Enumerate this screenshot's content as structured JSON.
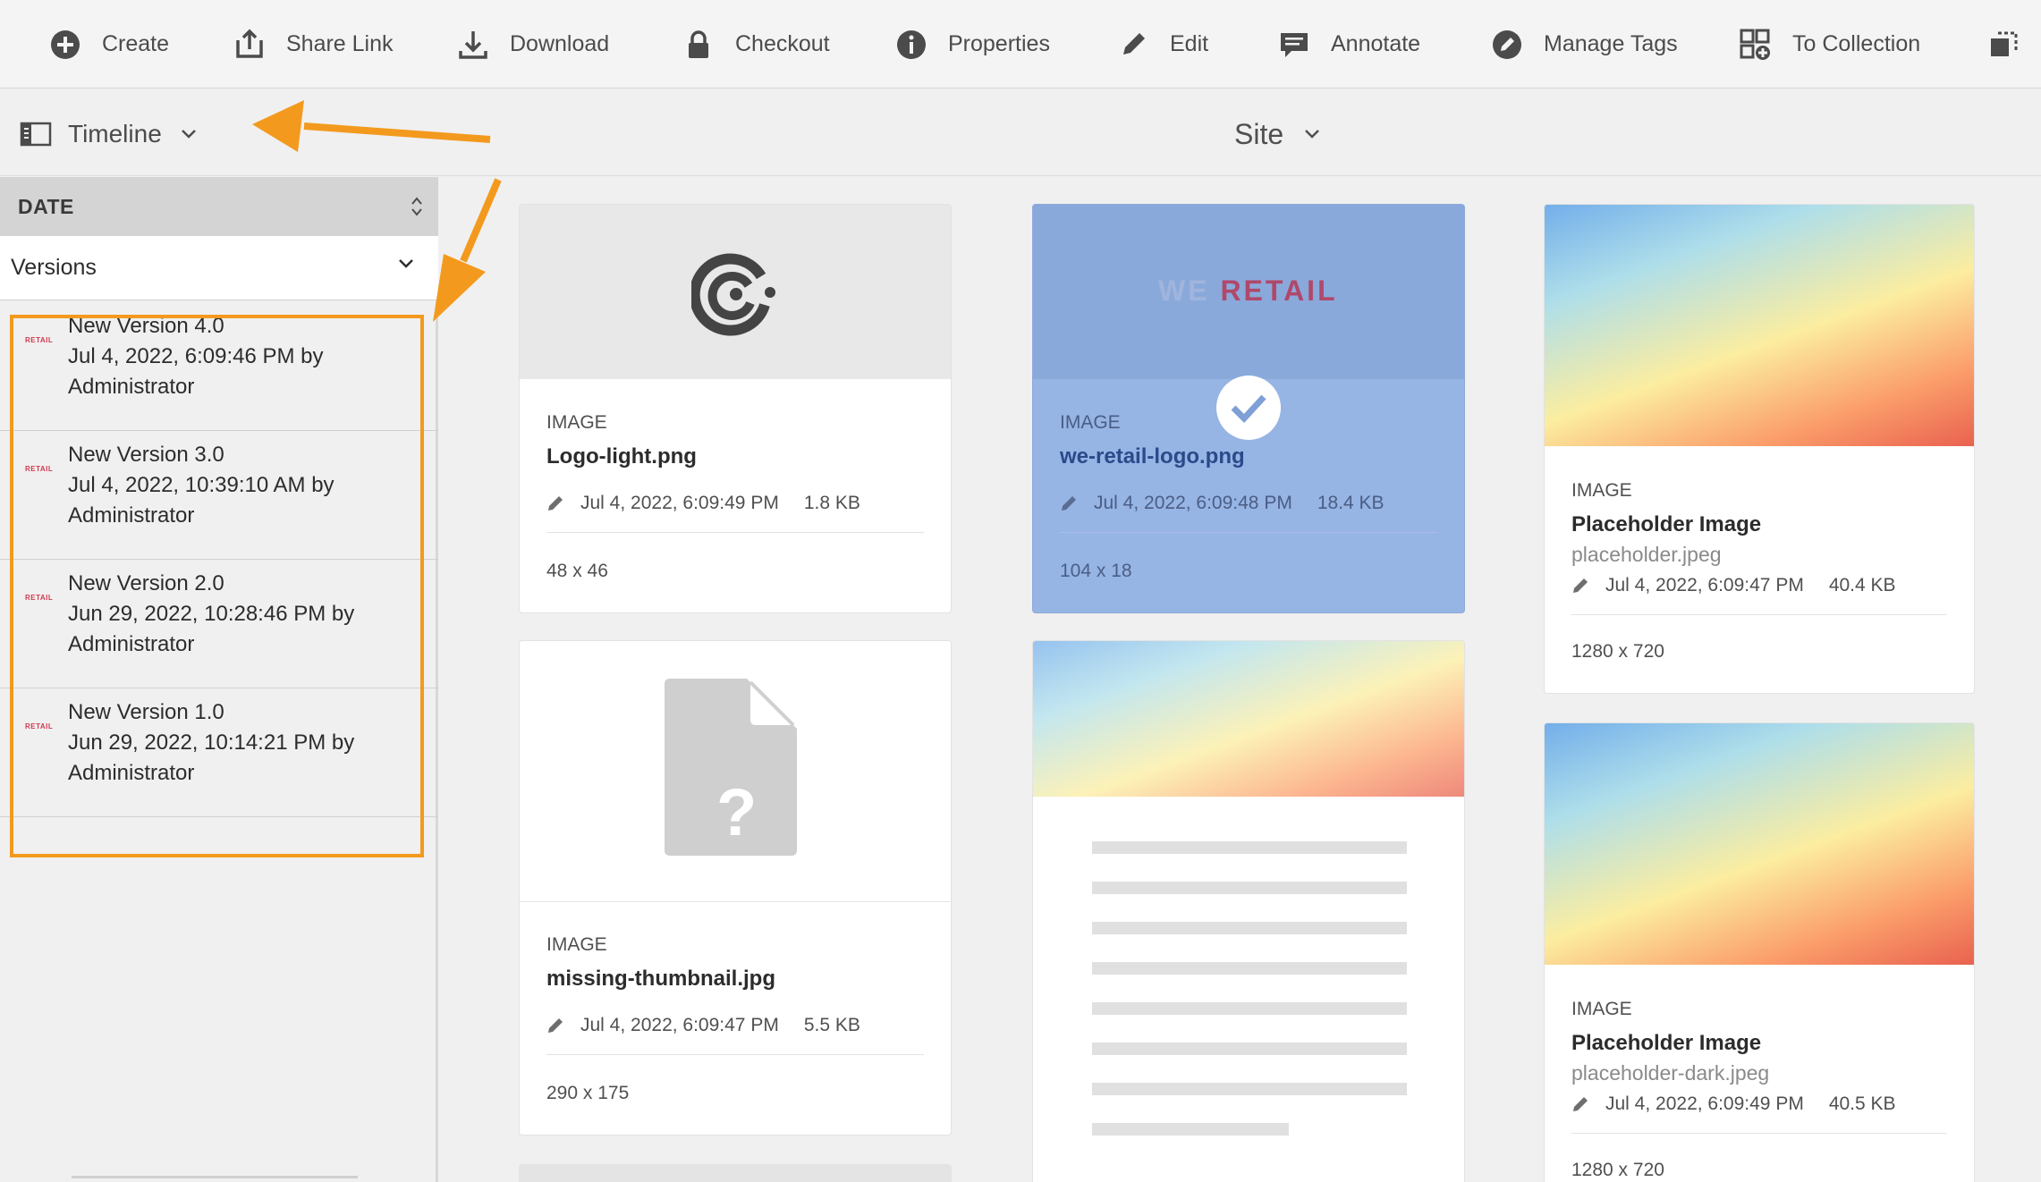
{
  "toolbar": {
    "items": [
      {
        "label": "Create",
        "icon": "plus-circle-icon"
      },
      {
        "label": "Share Link",
        "icon": "share-icon"
      },
      {
        "label": "Download",
        "icon": "download-icon"
      },
      {
        "label": "Checkout",
        "icon": "lock-icon"
      },
      {
        "label": "Properties",
        "icon": "info-icon"
      },
      {
        "label": "Edit",
        "icon": "pencil-icon"
      },
      {
        "label": "Annotate",
        "icon": "comment-icon"
      },
      {
        "label": "Manage Tags",
        "icon": "tag-icon"
      },
      {
        "label": "To Collection",
        "icon": "collection-icon"
      }
    ]
  },
  "rail_switch": {
    "label": "Timeline"
  },
  "site": {
    "label": "Site"
  },
  "rail": {
    "sort_label": "DATE",
    "filter_label": "Versions",
    "versions": [
      {
        "thumb": "RETAIL",
        "title": "New Version 4.0",
        "date": "Jul 4, 2022, 6:09:46 PM by",
        "author": "Administrator"
      },
      {
        "thumb": "RETAIL",
        "title": "New Version 3.0",
        "date": "Jul 4, 2022, 10:39:10 AM by",
        "author": "Administrator"
      },
      {
        "thumb": "RETAIL",
        "title": "New Version 2.0",
        "date": "Jun 29, 2022, 10:28:46 PM by",
        "author": "Administrator"
      },
      {
        "thumb": "RETAIL",
        "title": "New Version 1.0",
        "date": "Jun 29, 2022, 10:14:21 PM by",
        "author": "Administrator"
      }
    ]
  },
  "cards": {
    "logo_light": {
      "type": "IMAGE",
      "name": "Logo-light.png",
      "modified": "Jul 4, 2022, 6:09:49 PM",
      "size": "1.8 KB",
      "dims": "48 x 46"
    },
    "we_retail": {
      "type": "IMAGE",
      "name": "we-retail-logo.png",
      "modified": "Jul 4, 2022, 6:09:48 PM",
      "size": "18.4 KB",
      "dims": "104 x 18",
      "thumb_text_a": "WE",
      "thumb_text_b": "RETAIL",
      "selected": true
    },
    "placeholder": {
      "type": "IMAGE",
      "name": "Placeholder Image",
      "file": "placeholder.jpeg",
      "modified": "Jul 4, 2022, 6:09:47 PM",
      "size": "40.4 KB",
      "dims": "1280 x 720"
    },
    "missing": {
      "type": "IMAGE",
      "name": "missing-thumbnail.jpg",
      "modified": "Jul 4, 2022, 6:09:47 PM",
      "size": "5.5 KB",
      "dims": "290 x 175"
    },
    "placeholder_dark": {
      "type": "IMAGE",
      "name": "Placeholder Image",
      "file": "placeholder-dark.jpeg",
      "modified": "Jul 4, 2022, 6:09:49 PM",
      "size": "40.5 KB",
      "dims": "1280 x 720"
    }
  },
  "colors": {
    "accent": "#f39a1e",
    "selected": "#96b4e4",
    "brand_red": "#d03a50"
  }
}
